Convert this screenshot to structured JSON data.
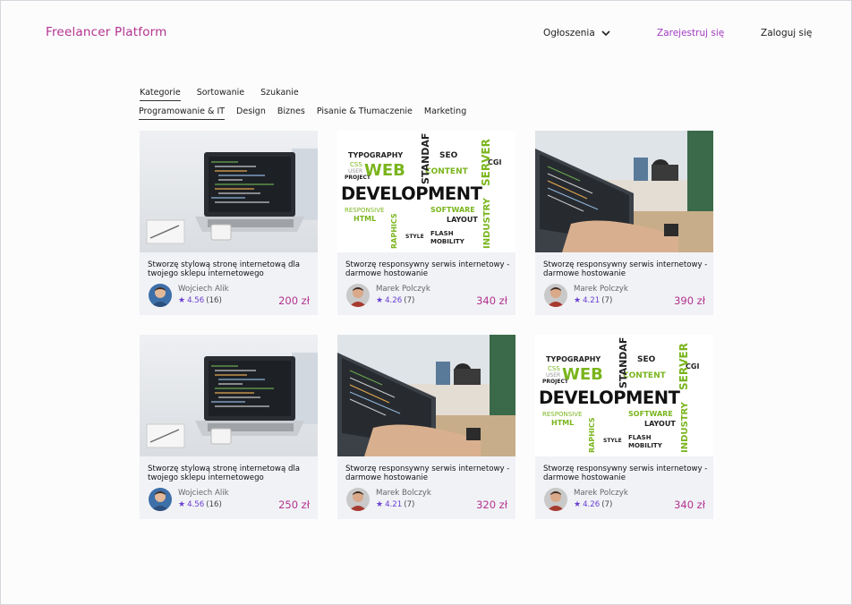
{
  "brand": "Freelancer Platform",
  "nav": {
    "announcements": "Ogłoszenia",
    "register": "Zarejestruj się",
    "login": "Zaloguj się"
  },
  "tabs_primary": [
    "Kategorie",
    "Sortowanie",
    "Szukanie"
  ],
  "tabs_secondary": [
    "Programowanie & IT",
    "Design",
    "Biznes",
    "Pisanie & Tłumaczenie",
    "Marketing"
  ],
  "wordcloud": {
    "big1": "WEB",
    "big2": "DEVELOPMENT",
    "words": [
      "TYPOGRAPHY",
      "SEO",
      "CGI",
      "CSS",
      "USER",
      "PROJECT",
      "STANDAF",
      "SERVER",
      "CONTENT",
      "SOFTWARE",
      "LAYOUT",
      "RESPONSIVE",
      "HTML",
      "MOBILITY",
      "INDUSTRY",
      "RAPHICS",
      "FLASH",
      "STYLE"
    ]
  },
  "listings": [
    {
      "title": "Stworzę stylową stronę internetową dla twojego sklepu internetowego",
      "author": "Wojciech Alik",
      "rating": "4.56",
      "reviews": "(16)",
      "price": "200 zł",
      "image": "laptop",
      "avatar": "blue"
    },
    {
      "title": "Stworzę responsywny serwis internetowy - darmowe hostowanie",
      "author": "Marek Polczyk",
      "rating": "4.26",
      "reviews": "(7)",
      "price": "340 zł",
      "image": "wordcloud",
      "avatar": "red"
    },
    {
      "title": "Stworzę responsywny serwis internetowy - darmowe hostowanie",
      "author": "Marek Polczyk",
      "rating": "4.21",
      "reviews": "(7)",
      "price": "390 zł",
      "image": "desk",
      "avatar": "red"
    },
    {
      "title": "Stworzę stylową stronę internetową dla twojego sklepu internetowego",
      "author": "Wojciech Alik",
      "rating": "4.56",
      "reviews": "(16)",
      "price": "250 zł",
      "image": "laptop",
      "avatar": "blue"
    },
    {
      "title": "Stworzę responsywny serwis internetowy - darmowe hostowanie",
      "author": "Marek Bolczyk",
      "rating": "4.21",
      "reviews": "(7)",
      "price": "320 zł",
      "image": "desk",
      "avatar": "red"
    },
    {
      "title": "Stworzę responsywny serwis internetowy - darmowe hostowanie",
      "author": "Marek Polczyk",
      "rating": "4.26",
      "reviews": "(7)",
      "price": "340 zł",
      "image": "wordcloud",
      "avatar": "red"
    }
  ],
  "colors": {
    "brand": "#b2338f",
    "register": "#a23bc0",
    "rating": "#6a3fd0",
    "price": "#b2338f",
    "card_bg": "#f1f2f6"
  }
}
